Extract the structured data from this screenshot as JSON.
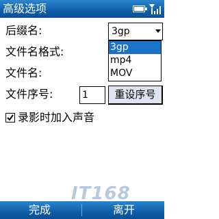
{
  "title_bar": {
    "title": "高级选项"
  },
  "form": {
    "suffix_label": "后缀名:",
    "suffix_value": "3gp",
    "suffix_options": [
      "3gp",
      "mp4",
      "MOV"
    ],
    "filename_format_label": "文件名格式:",
    "filename_label": "文件名:",
    "sequence_label": "文件序号:",
    "sequence_value": "1",
    "reset_button": "重设序号",
    "record_audio_label": "录影时加入声音",
    "record_audio_checked": true
  },
  "softkeys": {
    "left": "完成",
    "right": "离开"
  },
  "watermark": "IT168",
  "colors": {
    "bar": "#0f5ea8",
    "selection": "#1a73c5",
    "button": "#dde4ef"
  }
}
